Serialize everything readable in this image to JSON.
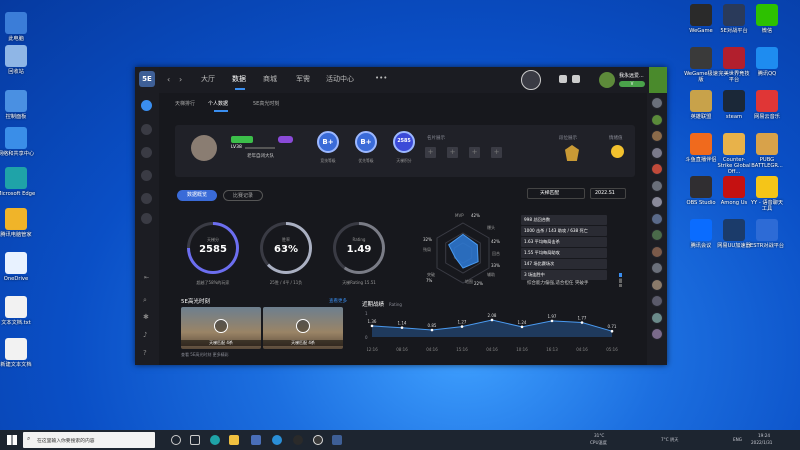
{
  "desktop_left": [
    {
      "label": "此电脑",
      "color": "#3b7dd8"
    },
    {
      "label": "回收站",
      "color": "#8fb6e6"
    },
    {
      "label": "控制面板",
      "color": "#4a90e2"
    },
    {
      "label": "网络和共享中心",
      "color": "#3a8ee8"
    },
    {
      "label": "Microsoft Edge",
      "color": "#1fa3a8"
    },
    {
      "label": "腾讯电脑管家",
      "color": "#f0b429"
    },
    {
      "label": "OneDrive",
      "color": "#e8f2ff"
    },
    {
      "label": "文本文档.txt",
      "color": "#f2f2f2"
    },
    {
      "label": "新建文本文档",
      "color": "#f2f2f2"
    }
  ],
  "desktop_right": [
    {
      "label": "WeGame",
      "color": "#2a2a2a"
    },
    {
      "label": "5E对战平台",
      "color": "#2a3a5a"
    },
    {
      "label": "微信",
      "color": "#2dc100"
    },
    {
      "label": "WeGame极速版",
      "color": "#3a3a3a"
    },
    {
      "label": "完美世界竞技平台",
      "color": "#b21f2d"
    },
    {
      "label": "腾讯QQ",
      "color": "#1e8cf0"
    },
    {
      "label": "英雄联盟",
      "color": "#c8a24a"
    },
    {
      "label": "steam",
      "color": "#1b2838"
    },
    {
      "label": "网易云音乐",
      "color": "#e03636"
    },
    {
      "label": "斗鱼直播伴侣",
      "color": "#f06a1d"
    },
    {
      "label": "Counter-Strike Global Off...",
      "color": "#e8b24a"
    },
    {
      "label": "PUBG BATTLEGR...",
      "color": "#d8a24a"
    },
    {
      "label": "OBS Studio",
      "color": "#302e31"
    },
    {
      "label": "Among Us",
      "color": "#c51111"
    },
    {
      "label": "YY - 语音聊天工具",
      "color": "#f5c518"
    },
    {
      "label": "腾讯会议",
      "color": "#0a6cff"
    },
    {
      "label": "网易UU加速器",
      "color": "#1b3b6a"
    },
    {
      "label": "ESTR对战平台",
      "color": "#2d6bd6"
    }
  ],
  "app": {
    "logo": "5E",
    "nav": [
      "大厅",
      "数据",
      "商城",
      "军需",
      "活动中心",
      "•••"
    ],
    "active_nav": "数据",
    "user_name": "我永远爱...",
    "user_badge": "V",
    "subtabs": [
      "天梯排行",
      "个人数据",
      "5E高光时刻"
    ],
    "active_subtab": "个人数据",
    "profile": {
      "level": "LV38",
      "team_tag": "老年自闭大队",
      "badges": [
        {
          "value": "B+",
          "label": "竞技等级"
        },
        {
          "value": "B+",
          "label": "优先等级"
        },
        {
          "value": "2585",
          "label": "天梯积分"
        }
      ],
      "title_show_label": "名片展示",
      "rank_label": "段位展示",
      "mood_label": "情绪值"
    },
    "filter_buttons": [
      "数据概览",
      "比赛记录"
    ],
    "mode_select": "天梯匹配",
    "season_select": "2022.S1",
    "rings": [
      {
        "label": "天梯分",
        "value": "2585",
        "sub": "超越了58%的玩家",
        "color": "#6c6ef0",
        "pct": 0.75
      },
      {
        "label": "胜率",
        "value": "63%",
        "sub": "25胜 / 4平 / 11负",
        "color": "#aab0c2",
        "pct": 0.63
      },
      {
        "label": "Rating",
        "value": "1.49",
        "sub": "天梯Rating 15.51",
        "color": "#7a7c86",
        "pct": 0.6
      }
    ],
    "radar": {
      "labels": [
        "MVP",
        "爆头",
        "回合",
        "辅助",
        "地图",
        "突破",
        "残局"
      ],
      "values": [
        "42%",
        "42%",
        "33%",
        "22%",
        "7%",
        "32%"
      ]
    },
    "stats": [
      "998 总回合数",
      "1000 击杀 / 143 助攻 / 638 死亡",
      "1.63 平均每局击杀",
      "1.55 平均每局助攻",
      "147 场比赛场次",
      "3 场连胜中"
    ],
    "stats_footer": "综合能力偏强,适合担任 突破手",
    "highlights": {
      "title": "5E高光时刻",
      "more": "查看更多",
      "clips": [
        {
          "caption": "天梯匹配 4杀"
        },
        {
          "caption": "天梯匹配 4杀"
        }
      ],
      "footer": "查看 5E高光时刻 更多精彩"
    },
    "recent": {
      "title": "近期战绩",
      "sub": "Rating",
      "y_top": "1",
      "y_bottom": "0",
      "points": [
        "1.36",
        "1.14",
        "0.85",
        "1.27",
        "2.08",
        "1.24",
        "1.97",
        "1.77",
        "0.71"
      ],
      "times": [
        "12:16",
        "08:16",
        "04:16",
        "15:16",
        "04:16",
        "10:16",
        "16:13",
        "04:16",
        "05:16"
      ]
    }
  },
  "taskbar": {
    "search": "在这里输入你要搜索的内容",
    "weather": "31°C",
    "weather_sub": "CPU温度",
    "temp": "7°C 阴天",
    "lang": "ENG",
    "time": "19:24",
    "date": "2022/1/31"
  }
}
